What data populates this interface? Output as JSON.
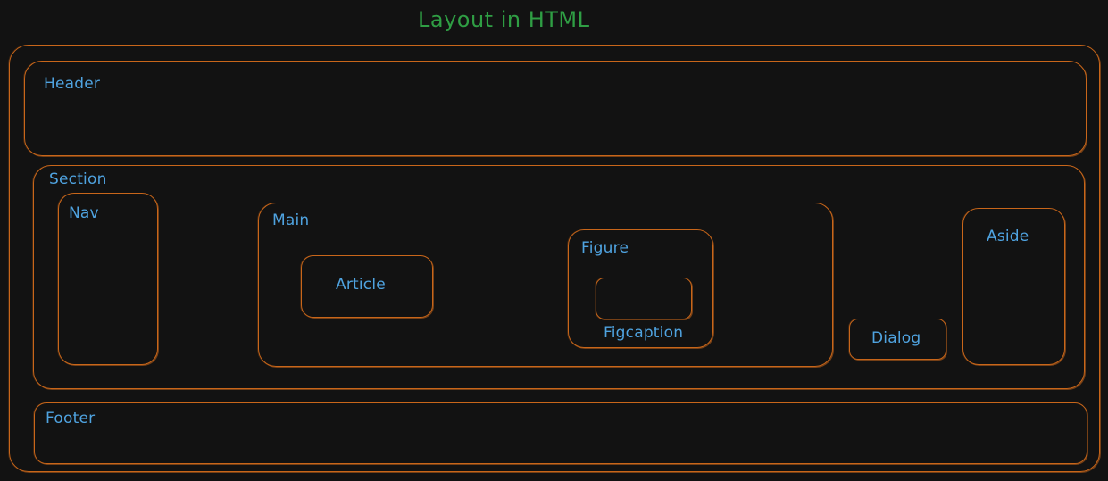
{
  "title": "Layout in HTML",
  "labels": {
    "header": "Header",
    "section": "Section",
    "nav": "Nav",
    "main": "Main",
    "article": "Article",
    "figure": "Figure",
    "figcaption": "Figcaption",
    "dialog": "Dialog",
    "aside": "Aside",
    "footer": "Footer"
  },
  "colors": {
    "background": "#121212",
    "outline": "#c8661a",
    "label": "#4fa3e0",
    "title": "#2f9e44"
  }
}
